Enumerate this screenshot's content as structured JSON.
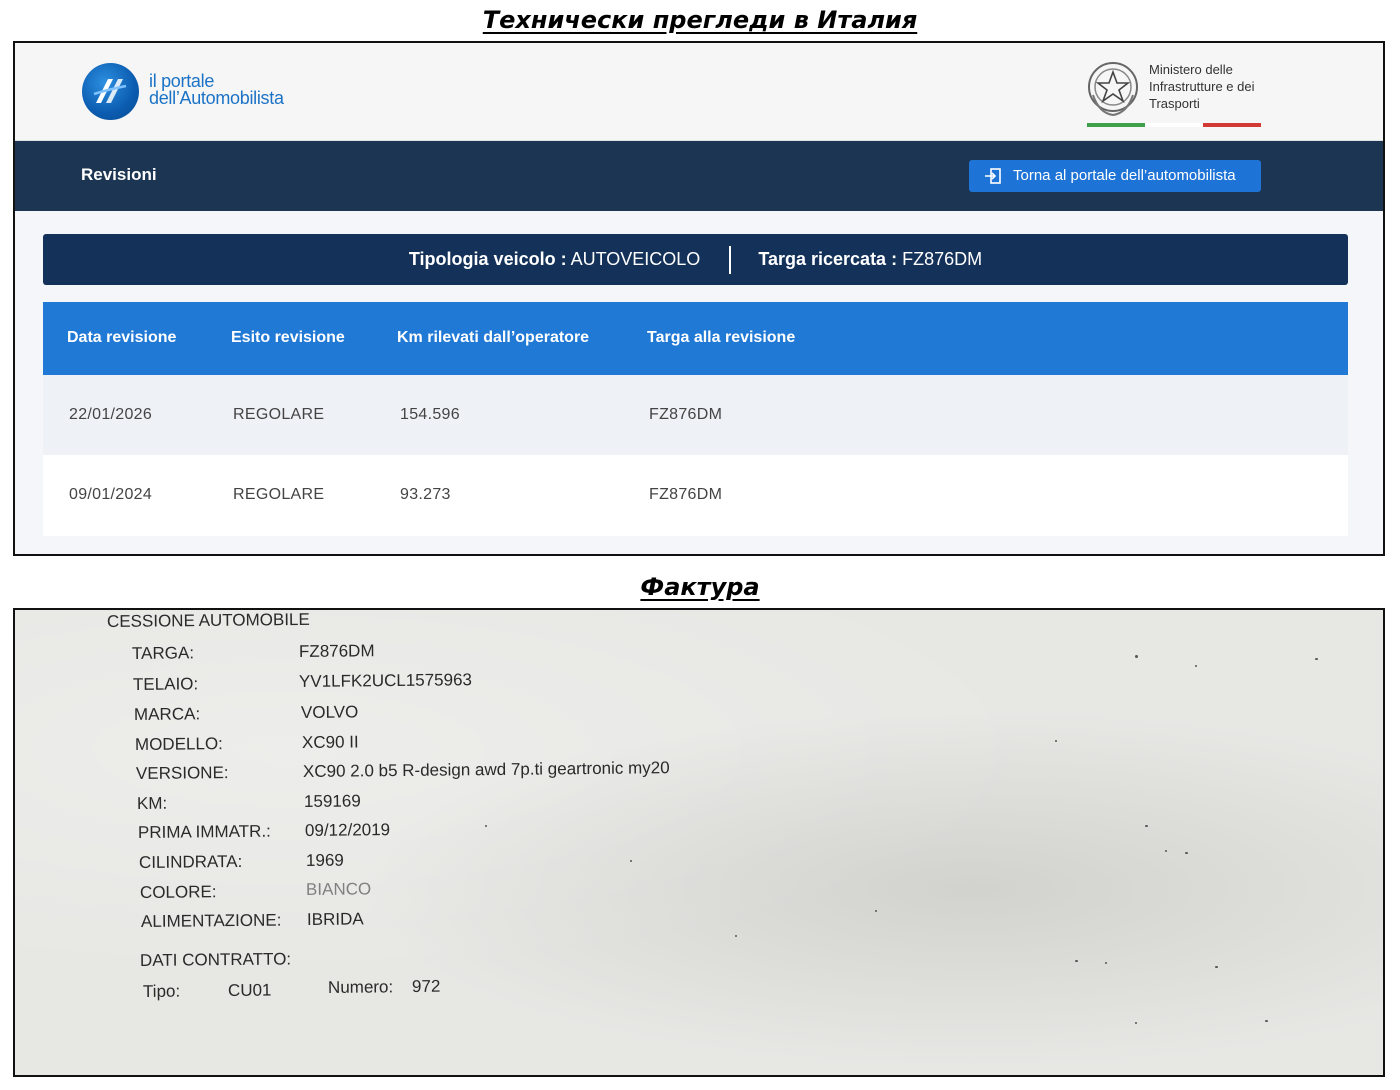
{
  "captions": {
    "top": "Технически прегледи в Италия",
    "bottom": "Фактура"
  },
  "portal": {
    "logo_line1": "il portale",
    "logo_line2": "dell’Automobilista",
    "ministry_line1": "Ministero delle",
    "ministry_line2": "Infrastrutture e dei",
    "ministry_line3": "Trasporti",
    "flag_colors": [
      "#3ea04a",
      "#ffffff",
      "#d13a35"
    ],
    "nav_title": "Revisioni",
    "back_button": "Torna al portale dell’automobilista",
    "info": {
      "vehicle_type_label": "Tipologia veicolo :",
      "vehicle_type_value": "AUTOVEICOLO",
      "plate_label": "Targa ricercata :",
      "plate_value": "FZ876DM"
    },
    "table": {
      "headers": [
        "Data revisione",
        "Esito revisione",
        "Km rilevati dall’operatore",
        "Targa alla revisione"
      ],
      "rows": [
        [
          "22/01/2026",
          "REGOLARE",
          "154.596",
          "FZ876DM"
        ],
        [
          "09/01/2024",
          "REGOLARE",
          "93.273",
          "FZ876DM"
        ]
      ]
    }
  },
  "invoice": {
    "heading": "CESSIONE AUTOMOBILE",
    "fields": [
      {
        "label": "TARGA:",
        "value": "FZ876DM"
      },
      {
        "label": "TELAIO:",
        "value": "YV1LFK2UCL1575963"
      },
      {
        "label": "MARCA:",
        "value": "VOLVO"
      },
      {
        "label": "MODELLO:",
        "value": "XC90 II"
      },
      {
        "label": "VERSIONE:",
        "value": "XC90 2.0 b5 R-design awd 7p.ti geartronic my20"
      },
      {
        "label": "KM:",
        "value": "159169"
      },
      {
        "label": "PRIMA IMMATR.:",
        "value": "09/12/2019"
      },
      {
        "label": "CILINDRATA:",
        "value": "1969"
      },
      {
        "label": "COLORE:",
        "value": "BIANCO"
      },
      {
        "label": "ALIMENTAZIONE:",
        "value": "IBRIDA"
      }
    ],
    "contract_heading": "DATI CONTRATTO:",
    "tipo_label": "Tipo:",
    "tipo_value": "CU01",
    "numero_label": "Numero:",
    "numero_value": "972"
  }
}
